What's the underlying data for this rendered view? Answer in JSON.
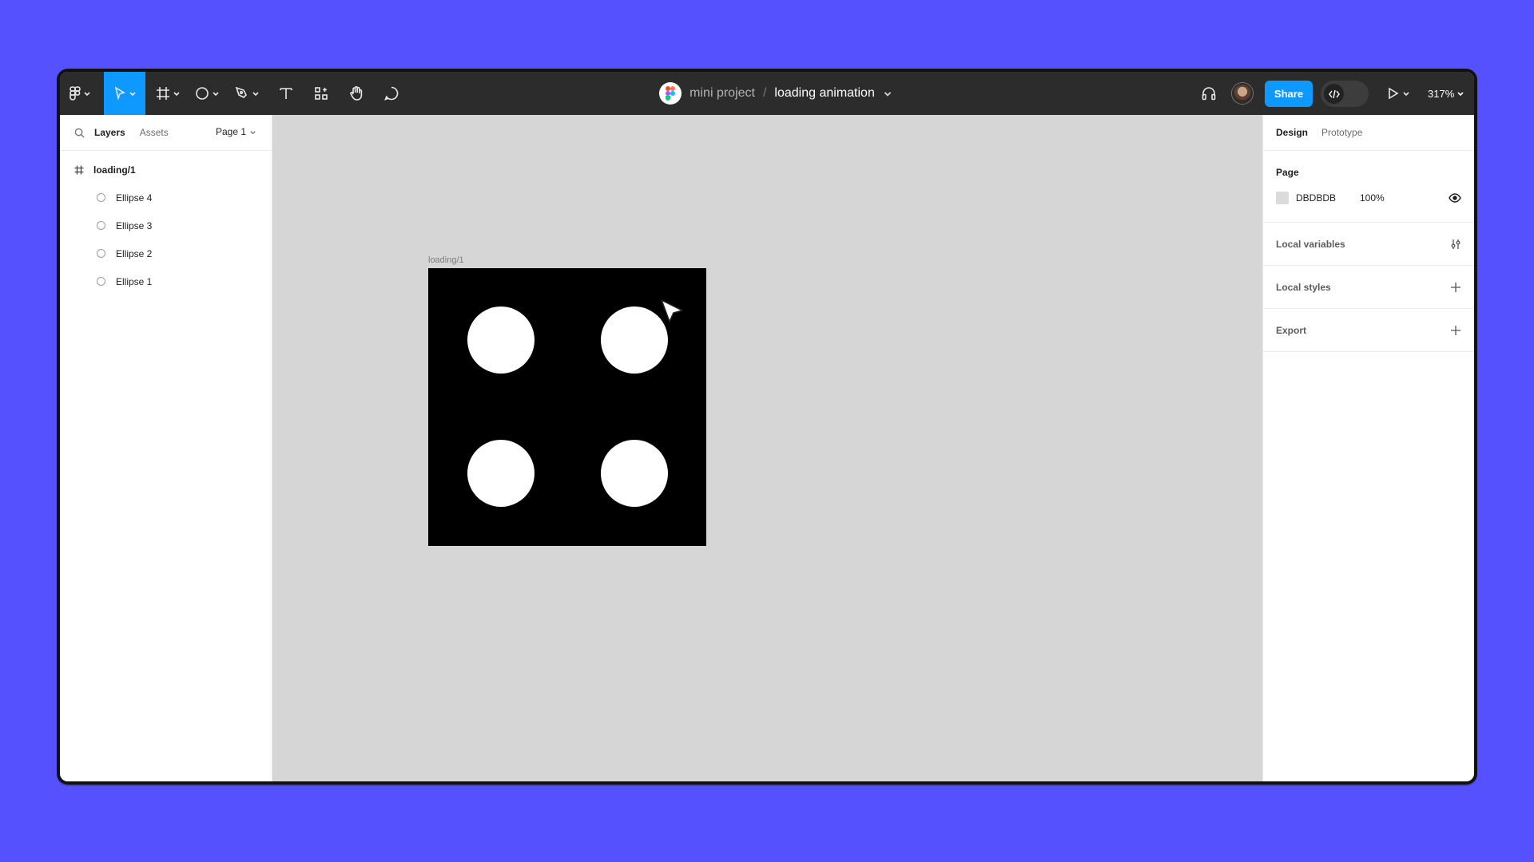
{
  "header": {
    "project_name": "mini project",
    "separator": "/",
    "file_name": "loading animation",
    "share_label": "Share",
    "zoom": "317%"
  },
  "toolbar_icons": [
    "main-menu-icon",
    "move-tool-icon",
    "frame-tool-icon",
    "shape-tool-icon",
    "pen-tool-icon",
    "text-tool-icon",
    "resources-icon",
    "hand-tool-icon",
    "comment-icon",
    "headphones-icon",
    "dev-mode-icon",
    "present-icon"
  ],
  "left_panel": {
    "tabs": [
      "Layers",
      "Assets"
    ],
    "page_selector": "Page 1",
    "frame": "loading/1",
    "layers": [
      "Ellipse 4",
      "Ellipse 3",
      "Ellipse 2",
      "Ellipse 1"
    ]
  },
  "canvas": {
    "frame_label": "loading/1",
    "frame_fill": "#000000",
    "dot_fill": "#FFFFFF"
  },
  "right_panel": {
    "tabs": [
      "Design",
      "Prototype"
    ],
    "page_heading": "Page",
    "page_color": "DBDBDB",
    "page_opacity": "100%",
    "local_variables": "Local variables",
    "local_styles": "Local styles",
    "export": "Export"
  },
  "help_label": "?",
  "colors": {
    "accent": "#0d99ff",
    "background": "#5551fe",
    "toolbar": "#2c2c2c",
    "canvas": "#d6d6d6"
  }
}
